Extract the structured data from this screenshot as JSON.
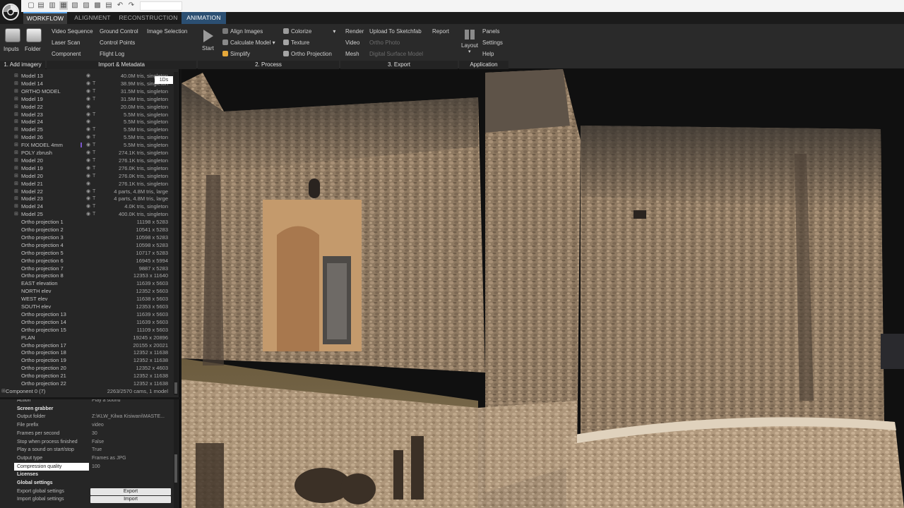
{
  "app": {
    "title_field": ""
  },
  "tabs": [
    {
      "label": "WORKFLOW",
      "active": true
    },
    {
      "label": "ALIGNMENT",
      "active": false
    },
    {
      "label": "RECONSTRUCTION",
      "active": false
    },
    {
      "label": "ANIMATION",
      "active": false
    }
  ],
  "ribbon": {
    "add_imagery": {
      "inputs": "Inputs",
      "folder": "Folder",
      "label": "1. Add imagery"
    },
    "import": {
      "video_sequence": "Video Sequence",
      "laser_scan": "Laser Scan",
      "component": "Component",
      "ground_control": "Ground Control",
      "control_points": "Control Points",
      "flight_log": "Flight Log",
      "image_selection": "Image Selection",
      "label": "Import & Metadata"
    },
    "process": {
      "start": "Start",
      "align_images": "Align Images",
      "calculate_model": "Calculate Model",
      "simplify": "Simplify",
      "colorize": "Colorize",
      "texture": "Texture",
      "ortho_projection": "Ortho Projection",
      "label": "2. Process"
    },
    "export": {
      "render": "Render",
      "video": "Video",
      "mesh": "Mesh",
      "upload_sketchfab": "Upload To Sketchfab",
      "ortho_photo": "Ortho Photo",
      "dsm": "Digital Surface Model",
      "report": "Report",
      "label": "3. Export"
    },
    "application": {
      "layout": "Layout",
      "panels": "Panels",
      "settings": "Settings",
      "help": "Help",
      "label": "Application"
    }
  },
  "tree": {
    "tooltip": "1Ds",
    "rows": [
      {
        "name": "Model 13",
        "value": "40.0M tris, singleton",
        "vis": "👁",
        "t": ""
      },
      {
        "name": "Model 14",
        "value": "38.9M tris, singleton",
        "vis": "👁",
        "t": "T"
      },
      {
        "name": "ORTHO MODEL",
        "value": "31.5M tris, singleton",
        "vis": "👁",
        "t": "T"
      },
      {
        "name": "Model 19",
        "value": "31.5M tris, singleton",
        "vis": "👁",
        "t": "T"
      },
      {
        "name": "Model 22",
        "value": "20.0M tris, singleton",
        "vis": "👁",
        "t": ""
      },
      {
        "name": "Model 23",
        "value": "5.5M tris, singleton",
        "vis": "👁",
        "t": "T"
      },
      {
        "name": "Model 24",
        "value": "5.5M tris, singleton",
        "vis": "👁",
        "t": ""
      },
      {
        "name": "Model 25",
        "value": "5.5M tris, singleton",
        "vis": "👁",
        "t": "T"
      },
      {
        "name": "Model 26",
        "value": "5.5M tris, singleton",
        "vis": "👁",
        "t": "T"
      },
      {
        "name": "FIX MODEL 4mm",
        "value": "5.5M tris, singleton",
        "vis": "👁",
        "t": "T"
      },
      {
        "name": "POLY zbrush",
        "value": "274.1K tris, singleton",
        "vis": "👁",
        "t": "T"
      },
      {
        "name": "Model 20",
        "value": "276.1K tris, singleton",
        "vis": "👁",
        "t": "T"
      },
      {
        "name": "Model 19",
        "value": "276.0K tris, singleton",
        "vis": "👁",
        "t": "T"
      },
      {
        "name": "Model 20",
        "value": "276.0K tris, singleton",
        "vis": "👁",
        "t": "T"
      },
      {
        "name": "Model 21",
        "value": "276.1K tris, singleton",
        "vis": "👁",
        "t": ""
      },
      {
        "name": "Model 22",
        "value": "4 parts, 4.8M tris, large",
        "vis": "👁",
        "t": "T"
      },
      {
        "name": "Model 23",
        "value": "4 parts, 4.8M tris, large",
        "vis": "👁",
        "t": "T"
      },
      {
        "name": "Model 24",
        "value": "4.0K tris, singleton",
        "vis": "👁",
        "t": "T"
      },
      {
        "name": "Model 25",
        "value": "400.0K tris, singleton",
        "vis": "👁",
        "t": "T"
      },
      {
        "name": "Ortho projection 1",
        "value": "11198 x 5283",
        "vis": "",
        "t": ""
      },
      {
        "name": "Ortho projection 2",
        "value": "10541 x 5283",
        "vis": "",
        "t": ""
      },
      {
        "name": "Ortho projection 3",
        "value": "10598 x 5283",
        "vis": "",
        "t": ""
      },
      {
        "name": "Ortho projection 4",
        "value": "10598 x 5283",
        "vis": "",
        "t": ""
      },
      {
        "name": "Ortho projection 5",
        "value": "10717 x 5283",
        "vis": "",
        "t": ""
      },
      {
        "name": "Ortho projection 6",
        "value": "16945 x 5994",
        "vis": "",
        "t": ""
      },
      {
        "name": "Ortho projection 7",
        "value": "9887 x 5283",
        "vis": "",
        "t": ""
      },
      {
        "name": "Ortho projection 8",
        "value": "12353 x 11640",
        "vis": "",
        "t": ""
      },
      {
        "name": "EAST elevation",
        "value": "11639 x 5603",
        "vis": "",
        "t": ""
      },
      {
        "name": "NORTH elev",
        "value": "12352 x 5603",
        "vis": "",
        "t": ""
      },
      {
        "name": "WEST elev",
        "value": "11638 x 5603",
        "vis": "",
        "t": ""
      },
      {
        "name": "SOUTH elev",
        "value": "12353 x 5603",
        "vis": "",
        "t": ""
      },
      {
        "name": "Ortho projection 13",
        "value": "11639 x 5603",
        "vis": "",
        "t": ""
      },
      {
        "name": "Ortho projection 14",
        "value": "11639 x 5603",
        "vis": "",
        "t": ""
      },
      {
        "name": "Ortho projection 15",
        "value": "11109 x 5603",
        "vis": "",
        "t": ""
      },
      {
        "name": "PLAN",
        "value": "19245 x 20896",
        "vis": "",
        "t": ""
      },
      {
        "name": "Ortho projection 17",
        "value": "20155 x 20021",
        "vis": "",
        "t": ""
      },
      {
        "name": "Ortho projection 18",
        "value": "12352 x 11638",
        "vis": "",
        "t": ""
      },
      {
        "name": "Ortho projection 19",
        "value": "12352 x 11638",
        "vis": "",
        "t": ""
      },
      {
        "name": "Ortho projection 20",
        "value": "12352 x 4603",
        "vis": "",
        "t": ""
      },
      {
        "name": "Ortho projection 21",
        "value": "12352 x 11638",
        "vis": "",
        "t": ""
      },
      {
        "name": "Ortho projection 22",
        "value": "12352 x 11638",
        "vis": "",
        "t": ""
      }
    ],
    "component": {
      "name": "Component 0 (7)",
      "value": "2263/2570 cams, 1 model"
    }
  },
  "props": {
    "rows": [
      {
        "key": "Action",
        "value": "Play a sound",
        "kind": "row"
      },
      {
        "key": "Screen grabber",
        "value": "",
        "kind": "header"
      },
      {
        "key": "Output folder",
        "value": "Z:\\KLW_Kilwa Kisiwani\\MASTE...",
        "kind": "row"
      },
      {
        "key": "File prefix",
        "value": "video",
        "kind": "row"
      },
      {
        "key": "Frames per second",
        "value": "30",
        "kind": "row"
      },
      {
        "key": "Stop when process finished",
        "value": "False",
        "kind": "row"
      },
      {
        "key": "Play a sound on start/stop",
        "value": "True",
        "kind": "row"
      },
      {
        "key": "Output type",
        "value": "Frames as JPG",
        "kind": "row"
      },
      {
        "key": "Compression quality",
        "value": "100",
        "kind": "sel"
      },
      {
        "key": "Licenses",
        "value": "",
        "kind": "header"
      },
      {
        "key": "Global settings",
        "value": "",
        "kind": "header"
      },
      {
        "key": "Export global settings",
        "value": "Export",
        "kind": "btn"
      },
      {
        "key": "Import global settings",
        "value": "Import",
        "kind": "btn"
      }
    ]
  },
  "colors": {
    "accent": "#5aa3e8",
    "animation_tab": "#2b4f72",
    "selection_mark": "#7a56c9"
  }
}
